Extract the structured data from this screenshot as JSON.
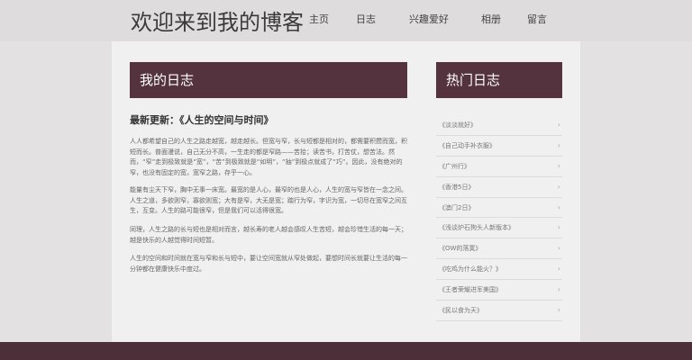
{
  "header": {
    "title": "欢迎来到我的博客"
  },
  "nav": [
    {
      "label": "主页"
    },
    {
      "label": "日志"
    },
    {
      "label": "兴趣爱好"
    },
    {
      "label": "相册"
    },
    {
      "label": "留言"
    }
  ],
  "main": {
    "heading": "我的日志",
    "post_title": "最新更新：《人生的空间与时间》",
    "paragraphs": [
      "人人都希望自己的人生之路走越宽，越走越长。但宽与窄，长与短都是相对的，都需要积攒而宽，积短而长。普面漫说，自己无分不高，一生走的都是窄路——苦拾；读苦书，打苦仗，想苦法。然而，“窄”走到极致就是“宽”，“苦”到极致就是“如明”，“抽”到极点就成了“巧”。因此，没有绝对的窄，也没有固定的宽，宽窄之路，存乎一心。",
      "能量有尘天下窄，胸中无事一床宽。最宽的是人心，最窄的也是人心，人生的宽与窄皆在一念之间。人生之道，多欲则窄，寡欲则宽；大有是窄，大无是宽；踏行为窄，字识为宽，一切尽在宽窄之间互生，互变。人生的路可能很窄，但是我们可以活得很宽。",
      "同理，人生之路的长与短也是相对而言，越长寿的老人越会感叹人生苦短，越会珍惜生活的每一天；越是快乐的人越觉得时间短暂。",
      "人生的空间和时间就在宽与窄和长与短中，要让空间宽就从窄处做起，要想时间长就要让生活的每一分钟都在健康快乐中度过。"
    ]
  },
  "sidebar": {
    "heading": "热门日志",
    "items": [
      {
        "label": "《淡淡就好》"
      },
      {
        "label": "《自己动手补衣服》"
      },
      {
        "label": "《广州行》"
      },
      {
        "label": "《香港5日》"
      },
      {
        "label": "《澳门2日》"
      },
      {
        "label": "《浅谈炉石狗头人新版本》"
      },
      {
        "label": "《OW的落寞》"
      },
      {
        "label": "《吃鸡为什么能火？》"
      },
      {
        "label": "《王者荣耀进军美国》"
      },
      {
        "label": "《民以食为天》"
      }
    ]
  },
  "colors": {
    "accent": "#54333f",
    "footer": "#4d2f3a",
    "page_bg": "#e3e1e1",
    "content_bg": "#f1f0f0"
  }
}
